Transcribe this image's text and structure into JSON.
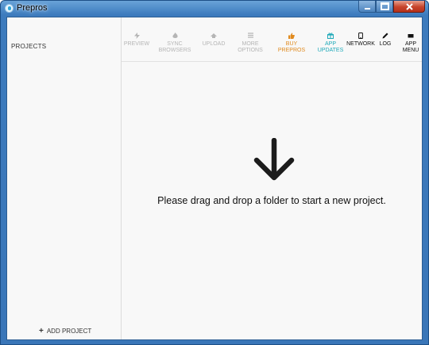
{
  "window": {
    "title": "Prepros"
  },
  "sidebar": {
    "heading": "PROJECTS",
    "add_project_label": "ADD PROJECT"
  },
  "toolbar": {
    "items": [
      {
        "label": "PREVIEW",
        "icon": "bolt-icon",
        "state": "disabled"
      },
      {
        "label": "SYNC\nBROWSERS",
        "icon": "fire-icon",
        "state": "disabled"
      },
      {
        "label": "UPLOAD",
        "icon": "upload-icon",
        "state": "disabled"
      },
      {
        "label": "MORE\nOPTIONS",
        "icon": "menu-icon",
        "state": "disabled"
      },
      {
        "label": "BUY\nPREPROS",
        "icon": "thumbs-up-icon",
        "state": "accent"
      },
      {
        "label": "APP\nUPDATES",
        "icon": "gift-icon",
        "state": "info"
      },
      {
        "label": "NETWORK",
        "icon": "mobile-icon",
        "state": "active"
      },
      {
        "label": "LOG",
        "icon": "pencil-icon",
        "state": "active"
      },
      {
        "label": "APP\nMENU",
        "icon": "square-icon",
        "state": "active"
      }
    ]
  },
  "main": {
    "drop_message": "Please drag and drop a folder to start a new project."
  },
  "colors": {
    "accent_orange": "#e08a1e",
    "accent_teal": "#1fa9b9",
    "disabled_gray": "#b5b5b5",
    "titlebar_blue": "#3d7bbd"
  }
}
